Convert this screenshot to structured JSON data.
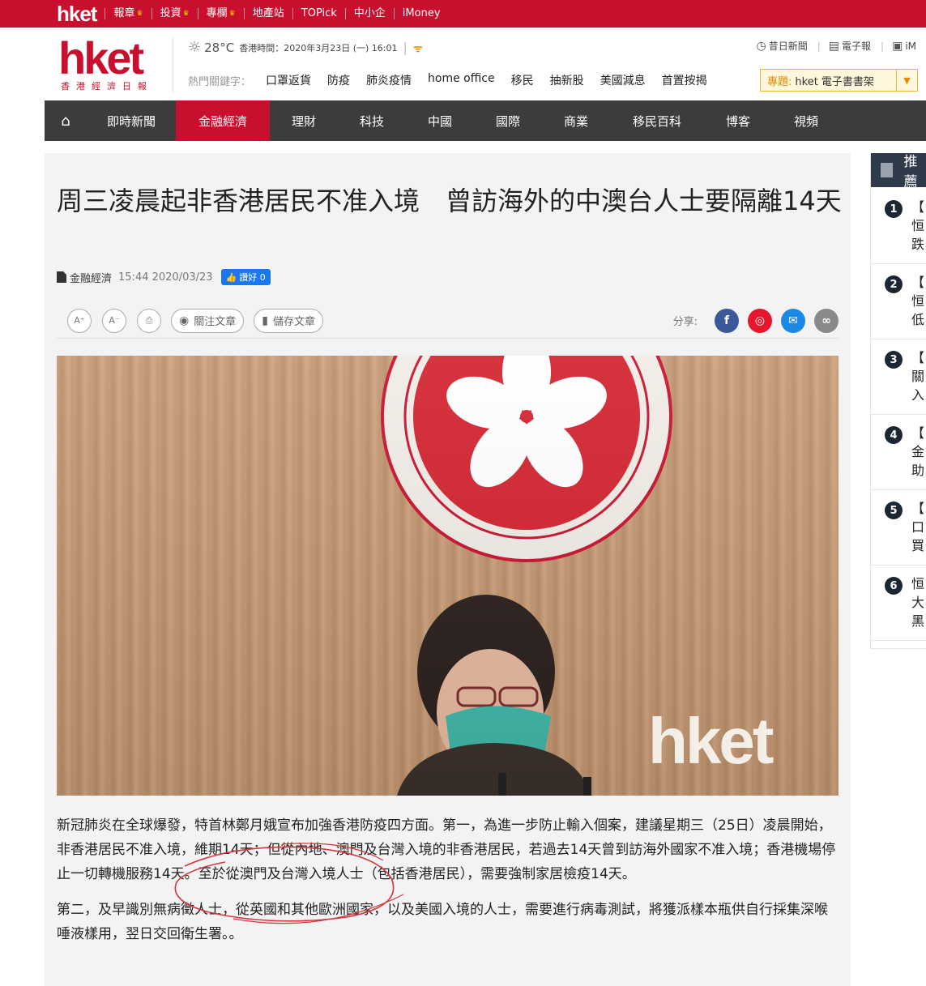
{
  "topbar": {
    "logo": "hket",
    "links": [
      {
        "label": "報章",
        "crown": true
      },
      {
        "label": "投資",
        "crown": true
      },
      {
        "label": "專欄",
        "crown": true
      },
      {
        "label": "地產站",
        "crown": false
      },
      {
        "label": "TOPick",
        "crown": false
      },
      {
        "label": "中小企",
        "crown": false
      },
      {
        "label": "iMoney",
        "crown": false
      }
    ]
  },
  "header": {
    "logo_word": "hket",
    "logo_sub": "香港經濟日報",
    "weather": {
      "temp": "28°C",
      "datetime": "香港時間：2020年3月23日 (一) 16:01"
    },
    "hot_label": "熱門關鍵字：",
    "hot_keywords": [
      "口罩返貨",
      "防疫",
      "肺炎疫情",
      "home office",
      "移民",
      "抽新股",
      "美國減息",
      "首置按揭"
    ],
    "right_links": [
      "昔日新聞",
      "電子報",
      "iM"
    ],
    "topic": {
      "label": "專題:",
      "text": "hket 電子書書架"
    }
  },
  "nav": {
    "items": [
      "即時新聞",
      "金融經濟",
      "理財",
      "科技",
      "中國",
      "國際",
      "商業",
      "移民百科",
      "博客",
      "視頻"
    ],
    "active_index": 1
  },
  "article": {
    "title": "周三凌晨起非香港居民不准入境　曾訪海外的中澳台人士要隔離14天",
    "category": "金融經濟",
    "time": "15:44 2020/03/23",
    "like_label": "讚好 0",
    "tools": {
      "font_up": "A⁺",
      "font_down": "A⁻",
      "follow": "關注文章",
      "save": "儲存文章"
    },
    "share_label": "分享:",
    "photo_watermark": "hket",
    "paragraphs": [
      "新冠肺炎在全球爆發，特首林鄭月娥宣布加強香港防疫四方面。第一，為進一步防止輸入個案，建議星期三（25日）凌晨開始，非香港居民不准入境，維期14天；但從內地、澳門及台灣入境的非香港居民，若過去14天曾到訪海外國家不准入境；香港機場停止一切轉機服務14天。至於從澳門及台灣入境人士（包括香港居民），需要強制家居檢疫14天。",
      "第二，及早識別無病徵人士，從英國和其他歐洲國家，以及美國入境的人士，需要進行病毒測試，將獲派樣本瓶供自行採集深喉唾液樣用，翌日交回衛生署。。"
    ]
  },
  "sidebar": {
    "heading": "推薦",
    "items": [
      {
        "num": "1",
        "text": "【\n恒\n跌"
      },
      {
        "num": "2",
        "text": "【\n恒\n低"
      },
      {
        "num": "3",
        "text": "【\n關\n入"
      },
      {
        "num": "4",
        "text": "【\n金\n助"
      },
      {
        "num": "5",
        "text": "【\n口\n買"
      },
      {
        "num": "6",
        "text": "恒\n大\n黑"
      }
    ]
  },
  "colors": {
    "brand_red": "#c8102e",
    "nav_dark": "#3c3c3c",
    "facebook": "#3b5998",
    "weibo": "#e6162d",
    "email": "#1e88e5",
    "link": "#8a8a8a"
  }
}
